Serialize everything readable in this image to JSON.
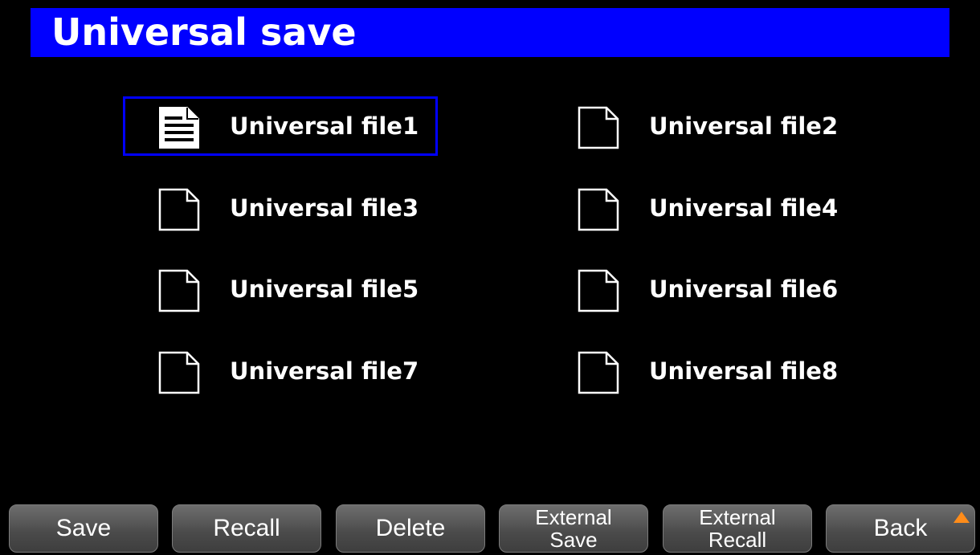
{
  "header": {
    "title": "Universal save"
  },
  "files": [
    {
      "label": "Universal file1",
      "icon": "document-with-lines-icon",
      "selected": true
    },
    {
      "label": "Universal file2",
      "icon": "blank-document-icon",
      "selected": false
    },
    {
      "label": "Universal file3",
      "icon": "blank-document-icon",
      "selected": false
    },
    {
      "label": "Universal file4",
      "icon": "blank-document-icon",
      "selected": false
    },
    {
      "label": "Universal file5",
      "icon": "blank-document-icon",
      "selected": false
    },
    {
      "label": "Universal file6",
      "icon": "blank-document-icon",
      "selected": false
    },
    {
      "label": "Universal file7",
      "icon": "blank-document-icon",
      "selected": false
    },
    {
      "label": "Universal file8",
      "icon": "blank-document-icon",
      "selected": false
    }
  ],
  "softkeys": {
    "save": "Save",
    "recall": "Recall",
    "delete": "Delete",
    "external_save_line1": "External",
    "external_save_line2": "Save",
    "external_recall_line1": "External",
    "external_recall_line2": "Recall",
    "back": "Back"
  },
  "colors": {
    "title_bar": "#0000ff",
    "selection_border": "#0000ff",
    "background": "#000000",
    "more_indicator": "#ff8c1a"
  }
}
